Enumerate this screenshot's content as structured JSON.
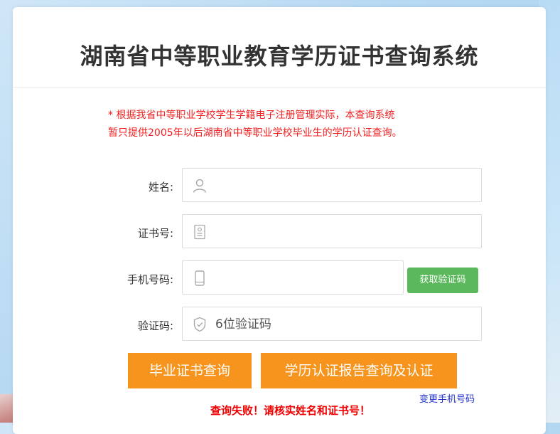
{
  "page": {
    "title": "湖南省中等职业教育学历证书查询系统",
    "notice_line1": "* 根据我省中等职业学校学生学籍电子注册管理实际，本查询系统",
    "notice_line2": "暂只提供2005年以后湖南省中等职业学校毕业生的学历认证查询。"
  },
  "form": {
    "name_label": "姓名:",
    "cert_label": "证书号:",
    "phone_label": "手机号码:",
    "code_label": "验证码:",
    "name_value": "",
    "name_placeholder": "",
    "cert_value": "",
    "cert_placeholder": "",
    "phone_value": "",
    "phone_placeholder": "",
    "code_value": "",
    "code_placeholder": "6位验证码",
    "get_code_button": "获取验证码"
  },
  "actions": {
    "cert_query_button": "毕业证书查询",
    "report_query_button": "学历认证报告查询及认证",
    "change_phone_link": "变更手机号码",
    "error_message": "查询失败！请核实姓名和证书号！"
  },
  "colors": {
    "notice_red": "#f02020",
    "button_orange": "#f7941d",
    "button_green": "#5cb85c",
    "link_blue": "#2233cc",
    "error_red": "#f00000"
  },
  "icons": {
    "name": "user-icon",
    "cert": "id-card-icon",
    "phone": "mobile-phone-icon",
    "code": "shield-check-icon"
  }
}
